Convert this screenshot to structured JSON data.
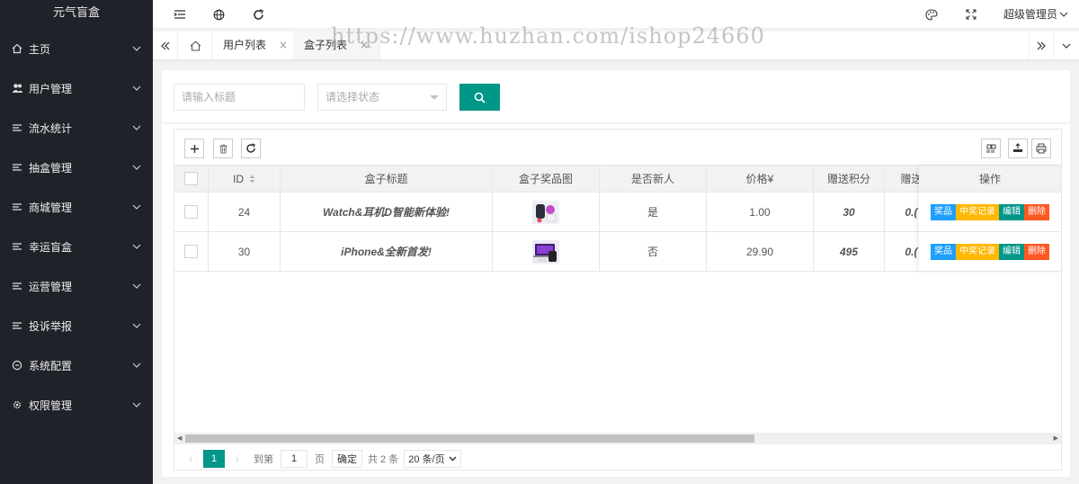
{
  "app": {
    "title": "元气盲盒"
  },
  "sidebar": {
    "items": [
      {
        "label": "主页",
        "icon": "home-icon"
      },
      {
        "label": "用户管理",
        "icon": "users-icon"
      },
      {
        "label": "流水统计",
        "icon": "list-icon"
      },
      {
        "label": "抽盒管理",
        "icon": "list-icon"
      },
      {
        "label": "商城管理",
        "icon": "list-icon"
      },
      {
        "label": "幸运盲盒",
        "icon": "list-icon"
      },
      {
        "label": "运营管理",
        "icon": "list-icon"
      },
      {
        "label": "投诉举报",
        "icon": "list-icon"
      },
      {
        "label": "系统配置",
        "icon": "settings-circle-icon"
      },
      {
        "label": "权限管理",
        "icon": "gear-icon"
      }
    ]
  },
  "header": {
    "user": "超级管理员",
    "icons": [
      "menu-fold-icon",
      "globe-icon",
      "refresh-icon",
      "theme-icon",
      "fullscreen-icon"
    ]
  },
  "tabs": {
    "items": [
      {
        "label": "用户列表",
        "close": "×",
        "active": false
      },
      {
        "label": "盒子列表",
        "close": "×",
        "active": true
      }
    ]
  },
  "watermark": "https://www.huzhan.com/ishop24660",
  "search": {
    "title_placeholder": "请输入标题",
    "status_placeholder": "请选择状态"
  },
  "table": {
    "columns": {
      "id": "ID",
      "title": "盒子标题",
      "image": "盒子奖品图",
      "is_new": "是否新人",
      "price": "价格¥",
      "points": "赠送积分",
      "points2": "赠送",
      "actions": "操作"
    },
    "rows": [
      {
        "id": "24",
        "title": "Watch&耳机D智能新体验!",
        "is_new": "是",
        "price": "1.00",
        "points": "30",
        "points2": "0.("
      },
      {
        "id": "30",
        "title": "iPhone&全新首发!",
        "is_new": "否",
        "price": "29.90",
        "points": "495",
        "points2": "0.("
      }
    ],
    "action_labels": {
      "prize": "奖品",
      "record": "中奖记录",
      "edit": "编辑",
      "delete": "删除"
    }
  },
  "pager": {
    "prev": "‹",
    "current": "1",
    "next": "›",
    "goto": "到第",
    "page_input": "1",
    "page_unit": "页",
    "confirm": "确定",
    "total": "共 2 条",
    "page_size": "20 条/页"
  },
  "colors": {
    "sidebar": "#20222a",
    "primary": "#009688",
    "blue": "#1e9fff",
    "orange": "#ffb800",
    "red": "#ff5722"
  }
}
